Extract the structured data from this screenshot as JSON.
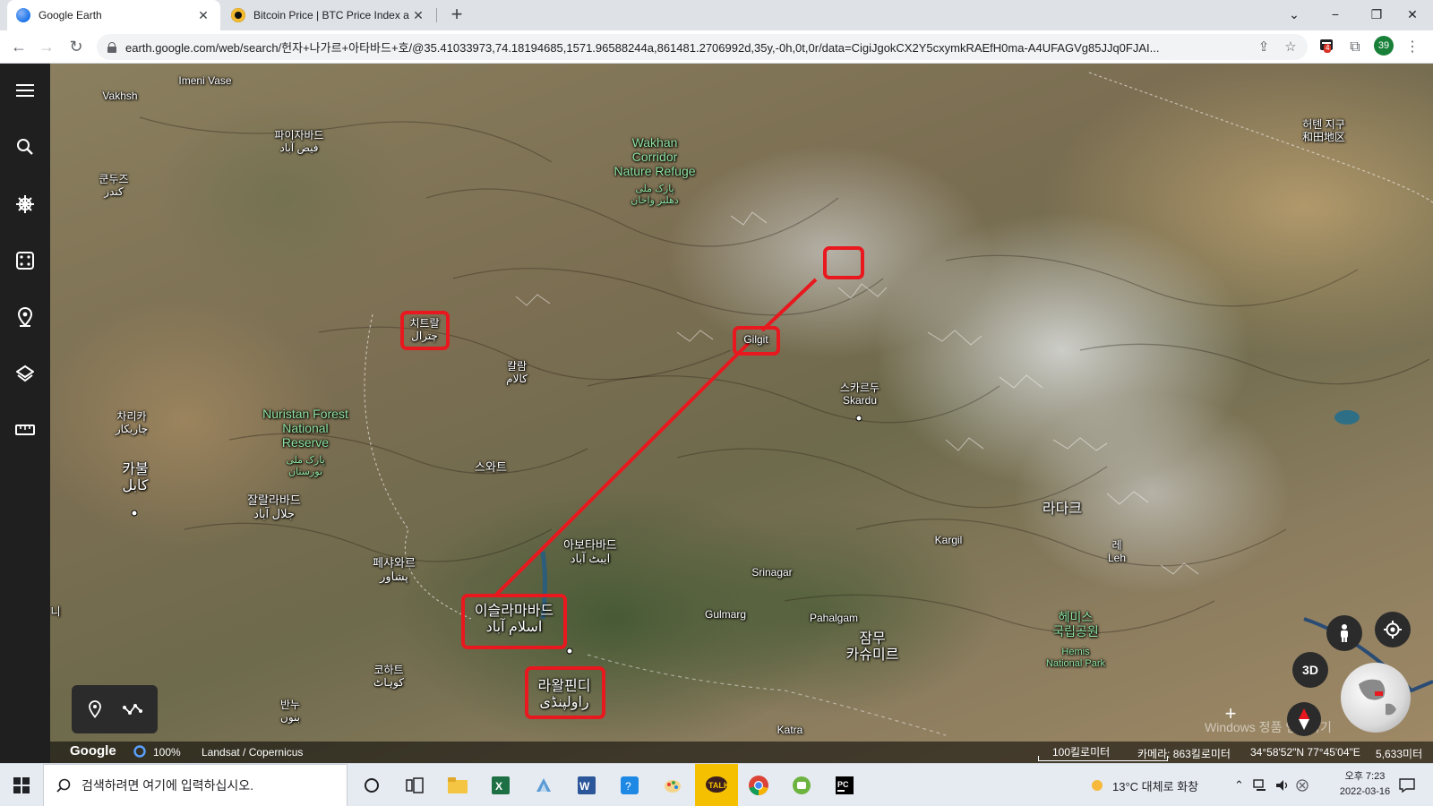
{
  "browser": {
    "tabs": [
      {
        "title": "Google Earth",
        "active": true,
        "favicon": "google-earth-icon"
      },
      {
        "title": "Bitcoin Price | BTC Price Index a",
        "active": false,
        "favicon": "coindesk-icon"
      }
    ],
    "new_tab_label": "+",
    "window_controls": {
      "minimize": "−",
      "maximize": "❐",
      "close": "✕"
    },
    "chevron_label": "⌄",
    "url": "earth.google.com/web/search/헌자+나가르+아타바드+호/@35.41033973,74.18194685,1571.96588244a,861481.2706992d,35y,-0h,0t,0r/data=CigiJgokCX2Y5cxymkRAEfH0ma-A4UFAGVg85JJq0FJAI...",
    "extension_badge": "4",
    "profile_label": "39"
  },
  "map": {
    "labels": [
      {
        "name": "vakhsh",
        "text": "Vakhsh"
      },
      {
        "name": "imeni-vase",
        "text": "Imeni Vase"
      },
      {
        "name": "faizabad",
        "text": "파이자바드\nفیض آباد"
      },
      {
        "name": "kunduz",
        "text": "쿤두즈\nکندز"
      },
      {
        "name": "wakhan",
        "text": "Wakhan\nCorridor\nNature Refuge"
      },
      {
        "name": "wakhan-ar",
        "text": "پارک ملی\nدهلیز واخان"
      },
      {
        "name": "chitral",
        "text": "치트랄\nچترال"
      },
      {
        "name": "kalam",
        "text": "칼람\nکالام"
      },
      {
        "name": "gilgit",
        "text": "Gilgit"
      },
      {
        "name": "skardu",
        "text": "스카르두\nSkardu"
      },
      {
        "name": "hotan",
        "text": "허톈 지구\n和田地区"
      },
      {
        "name": "charikar",
        "text": "차리카\nچاریکار"
      },
      {
        "name": "nuristan",
        "text": "Nuristan Forest\nNational\nReserve"
      },
      {
        "name": "nuristan-ar",
        "text": "پارک ملی\nنورستان"
      },
      {
        "name": "kabul",
        "text": "카불\nکابل"
      },
      {
        "name": "swat",
        "text": "스와트"
      },
      {
        "name": "jalalabad",
        "text": "잘랄라바드\nجلال آباد"
      },
      {
        "name": "abbottabad",
        "text": "아보타바드\nایبٹ آباد"
      },
      {
        "name": "peshawar",
        "text": "페샤와르\nپشاور"
      },
      {
        "name": "ladakh",
        "text": "라다크"
      },
      {
        "name": "kargil",
        "text": "Kargil"
      },
      {
        "name": "leh",
        "text": "레\nLeh"
      },
      {
        "name": "srinagar",
        "text": "Srinagar"
      },
      {
        "name": "gulmarg",
        "text": "Gulmarg"
      },
      {
        "name": "pahalgam",
        "text": "Pahalgam"
      },
      {
        "name": "hemis",
        "text": "헤미스\n국립공원"
      },
      {
        "name": "hemis-en",
        "text": "Hemis\nNational Park"
      },
      {
        "name": "islamabad",
        "text": "이슬라마바드\nاسلام آباد"
      },
      {
        "name": "jammu",
        "text": "잠무\n카슈미르"
      },
      {
        "name": "kohat",
        "text": "코하트\nکوہاٹ"
      },
      {
        "name": "rawalpindi",
        "text": "라왈핀디\nراولپنڈی"
      },
      {
        "name": "bannu",
        "text": "반누\nبنوں"
      },
      {
        "name": "katra",
        "text": "Katra"
      },
      {
        "name": "edge-left",
        "text": "니"
      }
    ],
    "windows_watermark": "Windows 정품 인증하기",
    "attribution": {
      "google": "Google",
      "zoom": "100%",
      "imagery": "Landsat / Copernicus",
      "scale": "100킬로미터",
      "camera": "카메라: 863킬로미터",
      "coords": "34°58'52\"N 77°45'04\"E",
      "elevation": "5,633미터"
    },
    "button_3d": "3D",
    "annotation_color": "#e8181e"
  },
  "taskbar": {
    "search_placeholder": "검색하려면 여기에 입력하십시오.",
    "weather": "13°C  대체로 화창",
    "time": "오후 7:23",
    "date": "2022-03-16",
    "apps": [
      "task-view-icon",
      "file-explorer-icon",
      "excel-icon",
      "app-icon",
      "word-icon",
      "app-icon",
      "paint-icon",
      "kakaotalk-icon",
      "chrome-icon",
      "app-icon",
      "pycharm-icon"
    ]
  }
}
